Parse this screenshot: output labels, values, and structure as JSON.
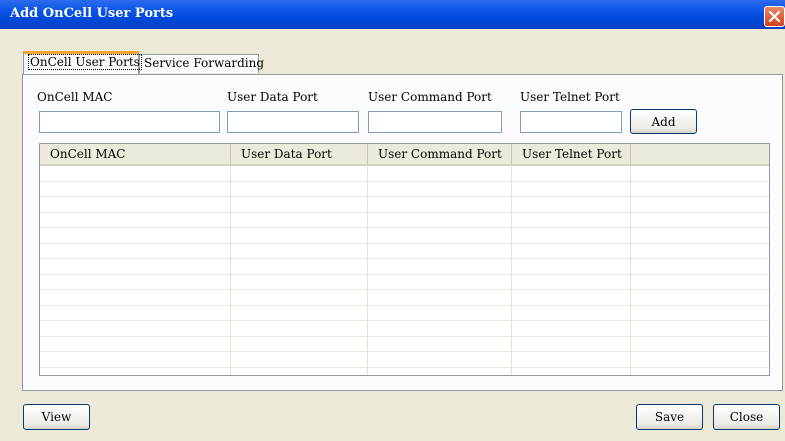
{
  "window": {
    "title": "Add OnCell User Ports"
  },
  "tabs": [
    {
      "label": "OnCell User Ports",
      "active": true
    },
    {
      "label": "Service Forwarding",
      "active": false
    }
  ],
  "form": {
    "mac_label": "OnCell MAC",
    "data_port_label": "User Data Port",
    "command_port_label": "User Command Port",
    "telnet_port_label": "User Telnet Port",
    "mac_value": "",
    "data_port_value": "",
    "command_port_value": "",
    "telnet_port_value": "",
    "add_button": "Add"
  },
  "table": {
    "columns": [
      "OnCell MAC",
      "User Data Port",
      "User Command Port",
      "User Telnet Port"
    ],
    "rows": []
  },
  "footer": {
    "view_button": "View",
    "save_button": "Save",
    "close_button": "Close"
  },
  "colors": {
    "titlebar": "#0a53e6",
    "active_tab_accent": "#f9a636",
    "close_button": "#d3401d"
  }
}
